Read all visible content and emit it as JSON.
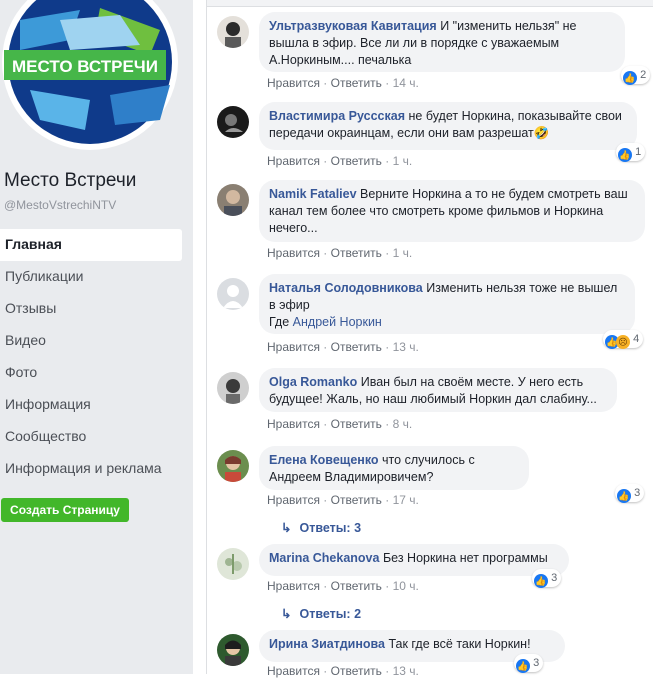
{
  "sidebar": {
    "logo_text": "МЕСТО ВСТРЕЧИ",
    "page_name": "Место Встречи",
    "page_handle": "@MestoVstrechiNTV",
    "nav": [
      "Главная",
      "Публикации",
      "Отзывы",
      "Видео",
      "Фото",
      "Информация",
      "Сообщество",
      "Информация и реклама"
    ],
    "create_button": "Создать Страницу"
  },
  "action_like": "Нравится",
  "action_reply": "Ответить",
  "separator": "·",
  "comments": [
    {
      "author": "Ультразвуковая Кавитация",
      "text": "И \"изменить нельзя\" не вышла в эфир. Все ли ли в порядке с уважаемым А.Норкиным.... печалька",
      "time": "14 ч.",
      "reactions": "2"
    },
    {
      "author": "Властимира Руссская",
      "text": "не будет Норкина, показывайте свои передачи окраинцам, если они вам разрешат🤣",
      "time": "1 ч.",
      "reactions": "1"
    },
    {
      "author": "Namik Fataliev",
      "text": "Верните Норкина а то не будем смотреть ваш канал тем более что смотреть кроме фильмов и Норкина нечего...",
      "time": "1 ч."
    },
    {
      "author": "Наталья Солодовникова",
      "text": "Изменить нельзя тоже не вышел в эфир",
      "text2": "Где ",
      "mention": "Андрей Норкин",
      "time": "13 ч.",
      "reactions": "4"
    },
    {
      "author": "Olga Romanko",
      "text": "Иван был на своём месте. У него есть будущее! Жаль, но наш любимый Норкин дал слабину...",
      "time": "8 ч."
    },
    {
      "author": "Елена Ковещенко",
      "text": "что случилось с Андреем Владимировичем?",
      "time": "17 ч.",
      "reactions": "3",
      "replies": "Ответы: 3"
    },
    {
      "author": "Marina Chekanova",
      "text": "Без Норкина нет программы",
      "time": "10 ч.",
      "reactions": "3",
      "replies": "Ответы: 2"
    },
    {
      "author": "Ирина Зиатдинова",
      "text": "Так где всё таки Норкин!",
      "time": "13 ч.",
      "reactions": "3"
    }
  ]
}
